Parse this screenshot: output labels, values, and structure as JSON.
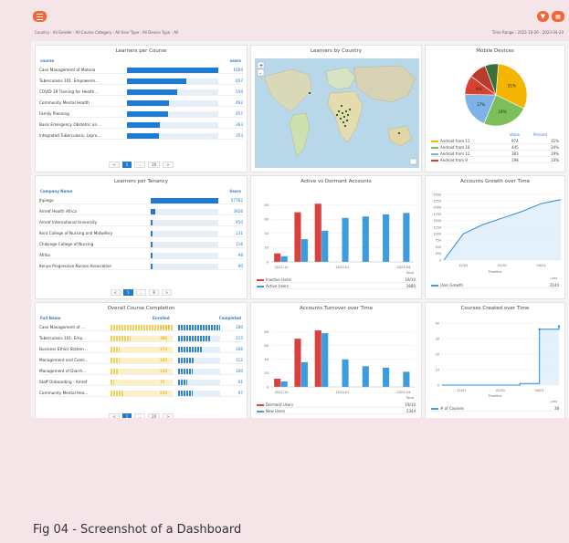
{
  "header": {
    "filters": "Country : All   Gender : All   Course Category : All   User Type : All   Device Type : All",
    "time_range": "Time Range : 2022-10-20 - 2023-04-20"
  },
  "learners_per_course": {
    "title": "Learners per Course",
    "col_course": "course",
    "col_users": "users",
    "rows": [
      {
        "name": "Case Management of Malaria",
        "users": "1009"
      },
      {
        "name": "Tuberculosis 101: Empowerin...",
        "users": "657"
      },
      {
        "name": "COVID-19 Training for Health ...",
        "users": "559"
      },
      {
        "name": "Community Mental Health",
        "users": "462"
      },
      {
        "name": "Family Planning",
        "users": "457"
      },
      {
        "name": "Basic Emergency Obstetric an...",
        "users": "363"
      },
      {
        "name": "Integrated Tuberculosis, Lepro...",
        "users": "353"
      }
    ],
    "pager": {
      "prev": "<",
      "page": "1",
      "dots": "...",
      "last": "20",
      "next": ">"
    }
  },
  "learners_by_country": {
    "title": "Learners by Country"
  },
  "mobile_devices": {
    "title": "Mobile Devices",
    "col_value": "Value",
    "col_percent": "Percent",
    "slice_labels": [
      "31%",
      "24%",
      "17%",
      "9%"
    ],
    "legend": [
      {
        "name": "Android from 11",
        "value": "974",
        "pct": "31%",
        "color": "#f4b400"
      },
      {
        "name": "Android from 10",
        "value": "445",
        "pct": "24%",
        "color": "#7cbf5a"
      },
      {
        "name": "Android from 12",
        "value": "383",
        "pct": "19%",
        "color": "#7fb3e8"
      },
      {
        "name": "Android from 9",
        "value": "198",
        "pct": "10%",
        "color": "#d9412f"
      }
    ]
  },
  "learners_per_tenancy": {
    "title": "Learners per Tenancy",
    "col_company": "Company Name",
    "col_users": "Users",
    "rows": [
      {
        "name": "Jhpiego",
        "users": "57782"
      },
      {
        "name": "Amref Health Africa",
        "users": "3926"
      },
      {
        "name": "Amref International University",
        "users": "450"
      },
      {
        "name": "Kent College of Nursing and Midwifery",
        "users": "131"
      },
      {
        "name": "Chikonge College of Nursing",
        "users": "116"
      },
      {
        "name": "Afrika",
        "users": "98"
      },
      {
        "name": "Kenya Progressive Nurses Association",
        "users": "90"
      }
    ],
    "pager": {
      "prev": "<",
      "page": "1",
      "dots": "...",
      "last": "8",
      "next": ">"
    }
  },
  "active_dormant": {
    "title": "Active vs Dormant Accounts",
    "y_ticks": [
      "0",
      "20",
      "40",
      "60",
      "80"
    ],
    "x_ticks": [
      "2022-10",
      "2023-01",
      "2023-04"
    ],
    "total_label": "Total",
    "legend": [
      {
        "name": "Inactive Users",
        "value": "19/10",
        "color": "#d9413f"
      },
      {
        "name": "Active Users",
        "value": "2680",
        "color": "#3d9be0"
      }
    ]
  },
  "accounts_growth": {
    "title": "Accounts Growth over Time",
    "y_ticks": [
      "0",
      "250",
      "500",
      "750",
      "1000",
      "1250",
      "1500",
      "1750",
      "2000",
      "2250",
      "2500"
    ],
    "x_ticks": [
      "12/01",
      "02/01",
      "04/01"
    ],
    "x_axis_label": "Timeline",
    "last_label": "Last",
    "legend": [
      {
        "name": "User Growth",
        "value": "2144",
        "color": "#3d9be0"
      }
    ]
  },
  "course_completion": {
    "title": "Overall Course Completion",
    "col_name": "Full Name",
    "col_enrolled": "Enrolled",
    "col_completed": "Completed",
    "rows": [
      {
        "name": "Case Management of ...",
        "enrolled": "1174",
        "completed": "280"
      },
      {
        "name": "Tuberculosis 101: Emp...",
        "enrolled": "386",
        "completed": "215"
      },
      {
        "name": "Business Ethics Statem...",
        "enrolled": "174",
        "completed": "166"
      },
      {
        "name": "Management and Contr...",
        "enrolled": "165",
        "completed": "112"
      },
      {
        "name": "Management of Diarrh...",
        "enrolled": "130",
        "completed": "100"
      },
      {
        "name": "Staff Onboarding - Amref",
        "enrolled": "75",
        "completed": "61"
      },
      {
        "name": "Community Mental Hea...",
        "enrolled": "259",
        "completed": "97"
      }
    ],
    "pager": {
      "prev": "<",
      "page": "1",
      "dots": "...",
      "last": "20",
      "next": ">"
    }
  },
  "accounts_turnover": {
    "title": "Accounts Turnover over Time",
    "y_ticks": [
      "0",
      "20",
      "40",
      "60",
      "80"
    ],
    "x_ticks": [
      "2022-10",
      "2023-01",
      "2023-04"
    ],
    "total_label": "Total",
    "legend": [
      {
        "name": "Dormant Users",
        "value": "19/10",
        "color": "#d9413f"
      },
      {
        "name": "New Users",
        "value": "2344",
        "color": "#3d9be0"
      }
    ]
  },
  "courses_created": {
    "title": "Courses Created over Time",
    "y_ticks": [
      "0",
      "10",
      "20",
      "30",
      "40"
    ],
    "x_ticks": [
      "12/01",
      "02/01",
      "04/01"
    ],
    "x_axis_label": "Timeline",
    "last_label": "Last",
    "legend": [
      {
        "name": "# of Courses",
        "value": "38",
        "color": "#3d9be0"
      }
    ]
  },
  "caption": "Fig 04 - Screenshot of a Dashboard",
  "chart_data": [
    {
      "type": "bar",
      "title": "Active vs Dormant Accounts",
      "categories": [
        "2022-10",
        "2022-11",
        "2022-12",
        "2023-01",
        "2023-02",
        "2023-03",
        "2023-04"
      ],
      "series": [
        {
          "name": "Inactive Users",
          "values": [
            12,
            70,
            82,
            null,
            null,
            null,
            null
          ],
          "color": "#d9413f"
        },
        {
          "name": "Active Users",
          "values": [
            8,
            32,
            44,
            62,
            64,
            67,
            69
          ],
          "color": "#3d9be0"
        }
      ],
      "ylim": [
        0,
        90
      ]
    },
    {
      "type": "line",
      "title": "Accounts Growth over Time",
      "x_axis_label": "Timeline",
      "x": [
        "11/01",
        "12/01",
        "01/01",
        "02/01",
        "03/01",
        "04/01",
        "04/20"
      ],
      "series": [
        {
          "name": "User Growth",
          "values": [
            0,
            1000,
            1350,
            1600,
            1850,
            2150,
            2300
          ]
        }
      ],
      "ylim": [
        0,
        2500
      ]
    },
    {
      "type": "bar",
      "title": "Accounts Turnover over Time",
      "categories": [
        "2022-10",
        "2022-11",
        "2022-12",
        "2023-01",
        "2023-02",
        "2023-03",
        "2023-04"
      ],
      "series": [
        {
          "name": "Dormant Users",
          "values": [
            12,
            70,
            82,
            null,
            null,
            null,
            null
          ],
          "color": "#d9413f"
        },
        {
          "name": "New Users",
          "values": [
            8,
            36,
            78,
            40,
            30,
            28,
            22
          ],
          "color": "#3d9be0"
        }
      ],
      "ylim": [
        0,
        90
      ]
    },
    {
      "type": "line",
      "title": "Courses Created over Time",
      "x_axis_label": "Timeline",
      "x": [
        "11/01",
        "12/01",
        "01/01",
        "02/01",
        "03/01",
        "04/01",
        "04/20"
      ],
      "series": [
        {
          "name": "# of Courses",
          "values": [
            0,
            0,
            0,
            0,
            1,
            36,
            38
          ]
        }
      ],
      "ylim": [
        0,
        40
      ]
    },
    {
      "type": "pie",
      "title": "Mobile Devices",
      "categories": [
        "Android from 11",
        "Android from 10",
        "Android from 12",
        "Android from 9",
        "Other 1",
        "Other 2"
      ],
      "values": [
        31,
        24,
        19,
        10,
        9,
        7
      ]
    }
  ]
}
